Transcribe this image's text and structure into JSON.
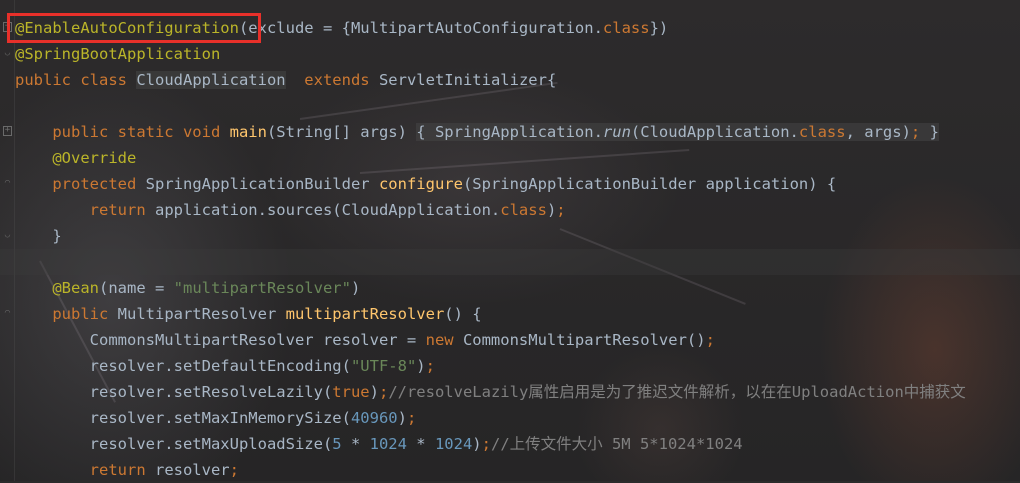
{
  "editor": {
    "lines": {
      "l1": {
        "ann": "@EnableAutoConfiguration",
        "rest": "(exclude = {MultipartAutoConfiguration.",
        "kw": "class",
        "end": "})"
      },
      "l2": {
        "ann": "@SpringBootApplication"
      },
      "l3": {
        "kw1": "public class ",
        "cls": "CloudApplication",
        "kw2": "  extends ",
        "rest": "ServletInitializer{"
      },
      "l5": {
        "kw": "public static void ",
        "fn": "main",
        "a": "(String[] args) ",
        "b": "{ SpringApplication.",
        "run": "run",
        "c": "(CloudApplication.",
        "kw2": "class",
        "d": ", args)",
        "semi": ";",
        "e": " }"
      },
      "l6": {
        "ann": "@Override"
      },
      "l7": {
        "kw": "protected ",
        "a": "SpringApplicationBuilder ",
        "fn": "configure",
        "b": "(SpringApplicationBuilder application) {"
      },
      "l8": {
        "kw": "return ",
        "a": "application.sources(CloudApplication.",
        "kw2": "class",
        "b": ")",
        "semi": ";"
      },
      "l9": {
        "a": "}"
      },
      "l11": {
        "ann": "@Bean",
        "a": "(name = ",
        "str": "\"multipartResolver\"",
        "b": ")"
      },
      "l12": {
        "kw": "public ",
        "a": "MultipartResolver ",
        "fn": "multipartResolver",
        "b": "() {"
      },
      "l13": {
        "a": "CommonsMultipartResolver resolver = ",
        "kw": "new ",
        "b": "CommonsMultipartResolver()",
        "semi": ";"
      },
      "l14": {
        "a": "resolver.setDefaultEncoding(",
        "str": "\"UTF-8\"",
        "b": ")",
        "semi": ";"
      },
      "l15": {
        "a": "resolver.setResolveLazily(",
        "kw": "true",
        "b": ")",
        "semi": ";",
        "cm": "//resolveLazily属性启用是为了推迟文件解析，以在在UploadAction中捕获文"
      },
      "l16": {
        "a": "resolver.setMaxInMemorySize(",
        "num": "40960",
        "b": ")",
        "semi": ";"
      },
      "l17": {
        "a": "resolver.setMaxUploadSize(",
        "n1": "5",
        "m1": " * ",
        "n2": "1024",
        "m2": " * ",
        "n3": "1024",
        "b": ")",
        "semi": ";",
        "cm": "//上传文件大小 5M 5*1024*1024"
      },
      "l18": {
        "kw": "return ",
        "a": "resolver",
        "semi": ";"
      }
    }
  }
}
